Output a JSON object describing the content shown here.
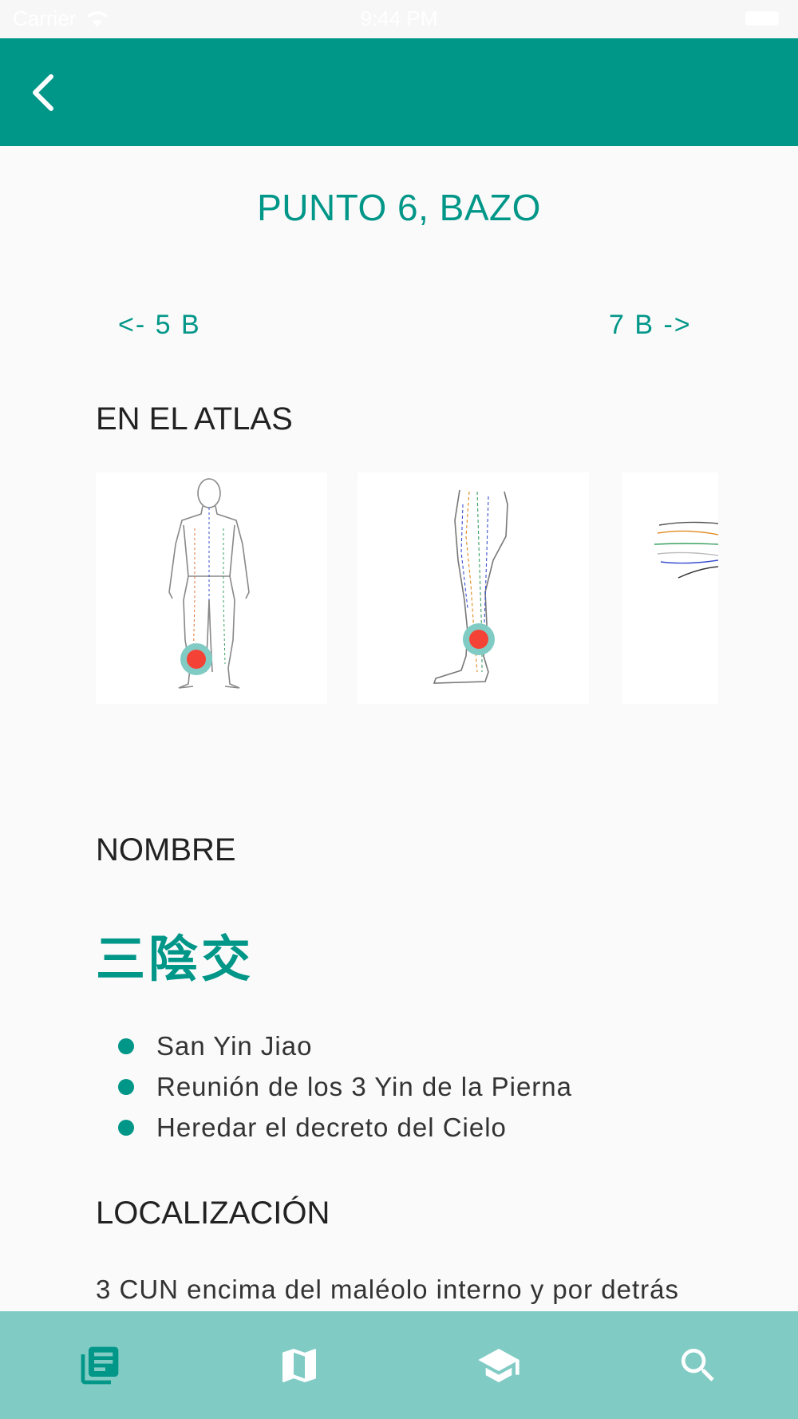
{
  "status_bar": {
    "carrier": "Carrier",
    "time": "9:44 PM"
  },
  "page": {
    "title": "PUNTO 6, BAZO",
    "prev_link": "<- 5 B",
    "next_link": "7 B ->"
  },
  "atlas": {
    "heading": "EN EL ATLAS",
    "cards": [
      {
        "icon": "full-body-diagram"
      },
      {
        "icon": "leg-diagram"
      },
      {
        "icon": "partial-meridian-diagram"
      }
    ]
  },
  "nombre": {
    "heading": "NOMBRE",
    "hanzi": "三陰交",
    "items": [
      "San Yin Jiao",
      "Reunión de los 3 Yin de la Pierna",
      "Heredar el decreto del Cielo"
    ]
  },
  "localizacion": {
    "heading": "LOCALIZACIÓN",
    "text": "3 CUN encima del maléolo interno y por detrás"
  },
  "colors": {
    "primary": "#009688",
    "bottom_nav": "#80cbc4",
    "marker": "#f44336",
    "marker_halo": "#80cbc4"
  },
  "bottom_nav": {
    "tabs": [
      {
        "icon": "book-list-icon",
        "active": true
      },
      {
        "icon": "map-icon",
        "active": false
      },
      {
        "icon": "school-icon",
        "active": false
      },
      {
        "icon": "search-icon",
        "active": false
      }
    ]
  }
}
